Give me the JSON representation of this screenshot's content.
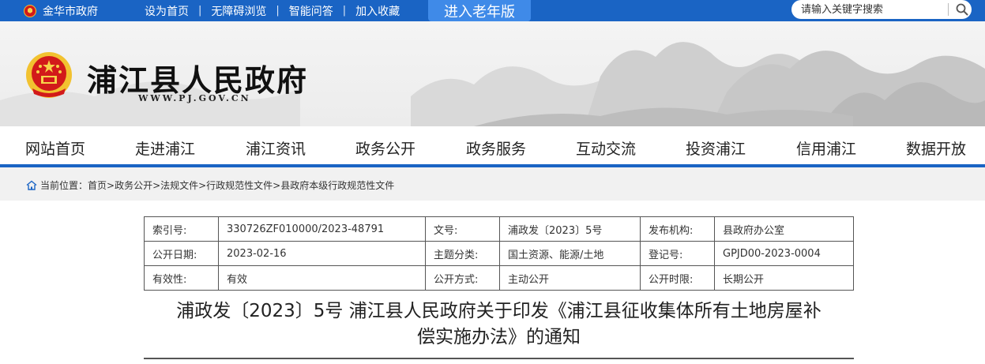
{
  "topbar": {
    "site_name": "金华市政府",
    "links": [
      "设为首页",
      "无障碍浏览",
      "智能问答",
      "加入收藏"
    ],
    "separator": "|",
    "elder_mode": "进入老年版",
    "search_placeholder": "请输入关键字搜索",
    "bg_color": "#1a64c4"
  },
  "banner": {
    "title": "浦江县人民政府",
    "url": "WWW.PJ.GOV.CN"
  },
  "nav": {
    "items": [
      "网站首页",
      "走进浦江",
      "浦江资讯",
      "政务公开",
      "政务服务",
      "互动交流",
      "投资浦江",
      "信用浦江",
      "数据开放"
    ]
  },
  "breadcrumb": {
    "label": "当前位置：",
    "path": "首页>政务公开>法规文件>行政规范性文件>县政府本级行政规范性文件"
  },
  "info_table": {
    "rows": [
      [
        "索引号:",
        "330726ZF010000/2023-48791",
        "文号:",
        "浦政发〔2023〕5号",
        "发布机构:",
        "县政府办公室"
      ],
      [
        "公开日期:",
        "2023-02-16",
        "主题分类:",
        "国土资源、能源/土地",
        "登记号:",
        "GPJD00-2023-0004"
      ],
      [
        "有效性:",
        "有效",
        "公开方式:",
        "主动公开",
        "公开时限:",
        "长期公开"
      ]
    ]
  },
  "document": {
    "title_line1": "浦政发〔2023〕5号 浦江县人民政府关于印发《浦江县征收集体所有土地房屋补",
    "title_line2": "偿实施办法》的通知"
  }
}
